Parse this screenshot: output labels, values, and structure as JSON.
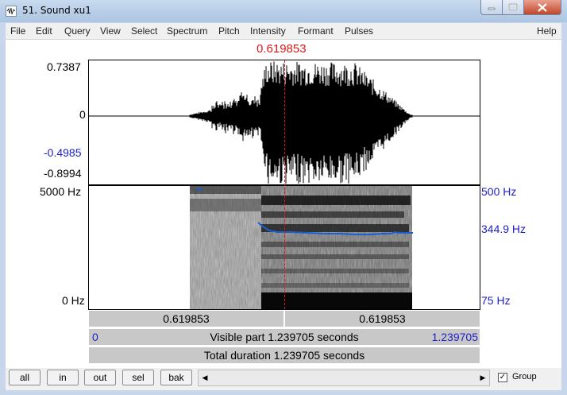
{
  "window": {
    "title": "51. Sound xu1",
    "controls": {
      "minimize": "minimize",
      "maximize": "maximize",
      "close": "close"
    }
  },
  "menu": [
    "File",
    "Edit",
    "Query",
    "View",
    "Select",
    "Spectrum",
    "Pitch",
    "Intensity",
    "Formant",
    "Pulses",
    "Help"
  ],
  "cursor": {
    "time_label": "0.619853"
  },
  "waveform": {
    "y_max": "0.7387",
    "y_zero": "0",
    "y_sel_min": "-0.4985",
    "y_min": "-0.8994"
  },
  "spectrogram": {
    "freq_max": "5000 Hz",
    "freq_min": "0 Hz",
    "pitch_max": "500 Hz",
    "pitch_value": "344.9 Hz",
    "pitch_min": "75 Hz"
  },
  "time_panels": {
    "left_segment": "0.619853",
    "right_segment": "0.619853",
    "visible_start": "0",
    "visible_label": "Visible part 1.239705 seconds",
    "visible_end": "1.239705",
    "total_label": "Total duration 1.239705 seconds"
  },
  "buttons": {
    "all": "all",
    "in": "in",
    "out": "out",
    "sel": "sel",
    "bak": "bak"
  },
  "group": {
    "label": "Group",
    "checked": true
  },
  "colors": {
    "cursor": "#e01818",
    "pitch": "#1a5fd6",
    "axis_blue": "#1d1dc8"
  }
}
